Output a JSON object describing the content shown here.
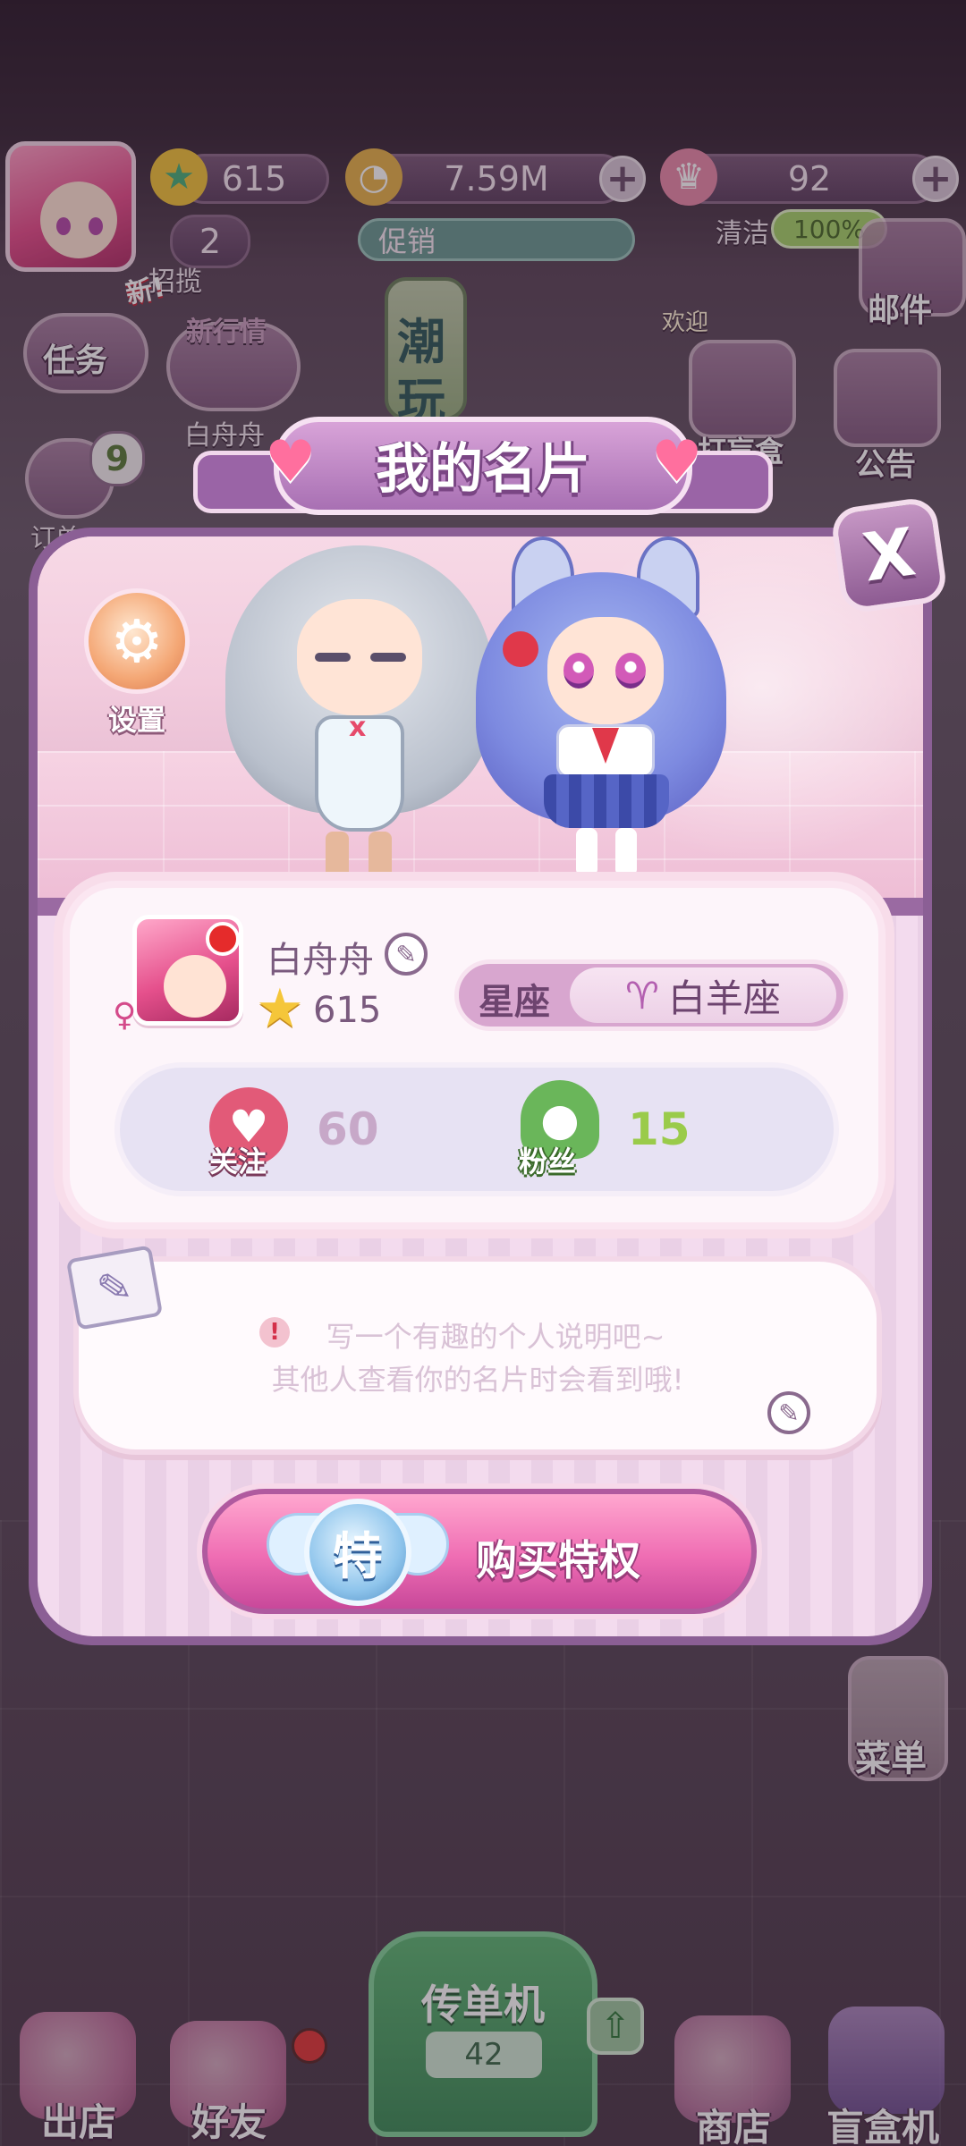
{
  "hud": {
    "stars": "615",
    "coins": "7.59M",
    "crowns": "92",
    "recruit_count": "2",
    "recruit_label": "招揽",
    "clean_label": "清洁",
    "clean_percent": "100%",
    "promo_label": "促销",
    "new_badge": "新!",
    "new_market_label": "新行情",
    "friend_name": "白舟舟",
    "orders_count": "9",
    "orders_label": "订单",
    "task_label": "任务"
  },
  "side_menu": {
    "mail": "邮件",
    "notice": "公告",
    "blindbox_shop": "打盲盒",
    "menu": "菜单",
    "chao_wan_1": "潮",
    "chao_wan_2": "玩",
    "welcome": "欢迎"
  },
  "bottom_nav": {
    "go_out": "出店",
    "friends": "好友",
    "flyer_machine": "传单机",
    "flyer_count": "42",
    "shop": "商店",
    "blindbox_machine": "盲盒机"
  },
  "dialog": {
    "title": "我的名片",
    "settings_label": "设置",
    "close_symbol": "X",
    "profile": {
      "name": "白舟舟",
      "stars": "615",
      "zodiac_key": "星座",
      "zodiac_symbol": "♈",
      "zodiac_value": "白羊座",
      "follow_label": "关注",
      "follow_count": "60",
      "fans_label": "粉丝",
      "fans_count": "15"
    },
    "bio": {
      "warning_symbol": "!",
      "line1": "写一个有趣的个人说明吧~",
      "line2": "其他人查看你的名片时会看到哦!"
    },
    "buy": {
      "badge": "特",
      "label": "购买特权"
    }
  },
  "colors": {
    "dialog_border": "#8b5f95",
    "buy_button": "#ef6db3",
    "follow_num": "#c7a8c8",
    "fans_num": "#9acb4a",
    "zodiac_symbol": "#b35fb0"
  }
}
